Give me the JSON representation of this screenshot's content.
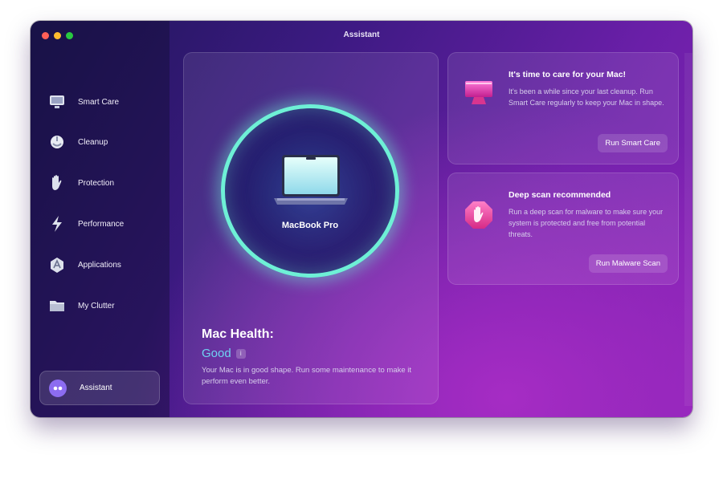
{
  "window": {
    "title": "Assistant"
  },
  "sidebar": {
    "items": [
      {
        "label": "Smart Care",
        "icon": "smart-care-icon"
      },
      {
        "label": "Cleanup",
        "icon": "cleanup-icon"
      },
      {
        "label": "Protection",
        "icon": "protection-icon"
      },
      {
        "label": "Performance",
        "icon": "performance-icon"
      },
      {
        "label": "Applications",
        "icon": "applications-icon"
      },
      {
        "label": "My Clutter",
        "icon": "my-clutter-icon"
      }
    ],
    "assistant": {
      "label": "Assistant",
      "icon": "assistant-icon",
      "selected": true
    }
  },
  "hero": {
    "device_name": "MacBook Pro",
    "health_title": "Mac Health:",
    "health_status": "Good",
    "info_badge": "i",
    "description": "Your Mac is in good shape. Run some maintenance to make it perform even better."
  },
  "cards": [
    {
      "title": "It's time to care for your Mac!",
      "description": "It's been a while since your last cleanup. Run Smart Care regularly to keep your Mac in shape.",
      "button": "Run Smart Care",
      "icon": "monitor-icon"
    },
    {
      "title": "Deep scan recommended",
      "description": "Run a deep scan for malware to make sure your system is protected and free from potential threats.",
      "button": "Run Malware Scan",
      "icon": "stop-hand-icon"
    }
  ],
  "colors": {
    "accent_teal": "#6ef0d6",
    "status_good": "#6fd3f2",
    "bg_start": "#1e1657",
    "bg_end": "#8a24b8"
  }
}
